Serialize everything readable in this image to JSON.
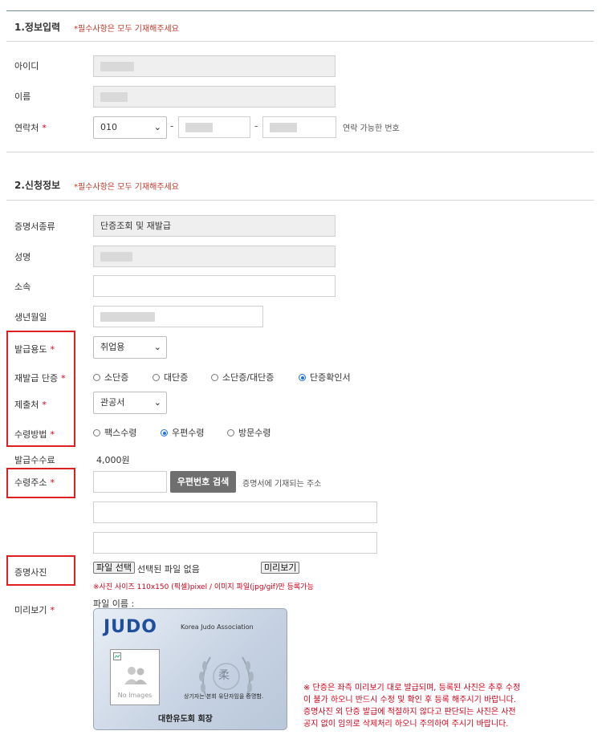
{
  "section1": {
    "title": "1.정보입력",
    "required_note": "*필수사항은 모두 기재해주세요"
  },
  "fields1": {
    "id_label": "아이디",
    "name_label": "이름",
    "phone_label": "연락처",
    "phone_prefix": "010",
    "phone_hint": "연락 가능한 번호",
    "dash": "-"
  },
  "section2": {
    "title": "2.신청정보",
    "required_note": "*필수사항은 모두 기재해주세요"
  },
  "fields2": {
    "cert_type_label": "증명서종류",
    "cert_type_value": "단증조회 및 재발급",
    "full_name_label": "성명",
    "affiliation_label": "소속",
    "birthdate_label": "생년월일",
    "purpose_label": "발급용도",
    "purpose_value": "취업용",
    "reissue_label": "재발급 단증",
    "reissue_options": [
      "소단증",
      "대단증",
      "소단증/대단증",
      "단증확인서"
    ],
    "submit_to_label": "제출처",
    "submit_to_value": "관공서",
    "receive_label": "수령방법",
    "receive_options": [
      "팩스수령",
      "우편수령",
      "방문수령"
    ],
    "fee_label": "발급수수료",
    "fee_value": "4,000원",
    "address_label": "수령주소",
    "zip_search_button": "우편번호 검색",
    "address_hint": "증명서에 기재되는 주소",
    "photo_label": "증명사진",
    "file_button": "파일 선택",
    "file_status": "선택된 파일 없음",
    "preview_button": "미리보기",
    "photo_note": "※사진 사이즈 110x150 (픽셀)pixel / 이미지 파일(jpg/gif)만 등록가능",
    "preview_label": "미리보기",
    "file_name_label": "파일 이름 :"
  },
  "card": {
    "brand": "JUDO",
    "association": "Korea Judo Association",
    "no_image": "No Images",
    "emblem_char": "柔",
    "certify_text": "상기자는 본회 유단자임을 증명함.",
    "signature": "대한유도회 회장"
  },
  "notice": {
    "lines": [
      "※ 단증은 좌측 미리보기 대로 발급되며, 등록된 사진은 추후 수정",
      "이 불가 하오니 반드시 수정 및 확인 후 등록 해주시기 바랍니다.",
      "증명사진 외 단증 발급에 적절하지 않다고 판단되는 사진은 사전",
      "공지 없이 임의로 삭제처리 하오니 주의하여 주시기 바랍니다."
    ]
  },
  "colors": {
    "required": "#d0021b",
    "highlight_box": "#e02020",
    "radio_selected": "#1a73e8",
    "brand_blue": "#1f4e9c"
  },
  "state": {
    "reissue_selected": "단증확인서",
    "receive_selected": "우편수령"
  }
}
